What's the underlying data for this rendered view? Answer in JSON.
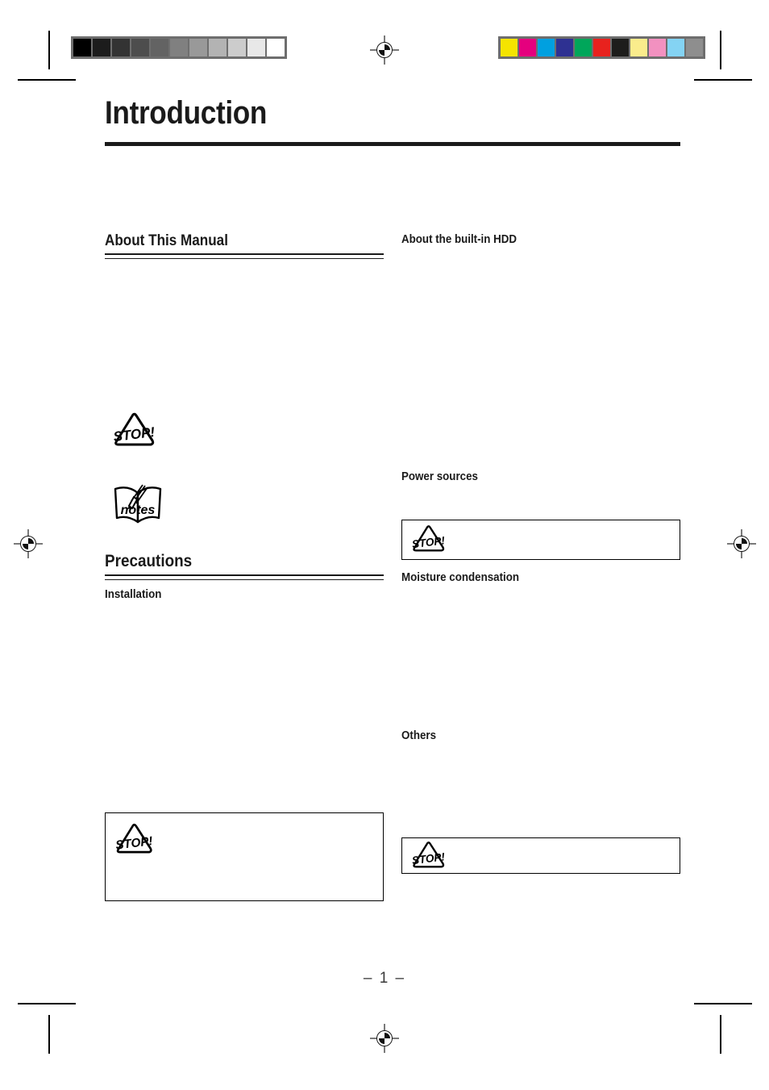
{
  "document": {
    "chapter_title": "Introduction",
    "page_number": "– 1 –"
  },
  "calibration": {
    "gray_bar": {
      "name": "grayscale-step-wedge",
      "swatches": [
        "#000000",
        "#1c1c1c",
        "#333333",
        "#4d4d4d",
        "#636363",
        "#808080",
        "#999999",
        "#b3b3b3",
        "#cccccc",
        "#e8e8e8",
        "#ffffff"
      ]
    },
    "color_bar": {
      "name": "process-color-bar",
      "swatches": [
        "#f5e400",
        "#e5007e",
        "#00a0e0",
        "#2e3192",
        "#00a65a",
        "#e8221e",
        "#1d1d1b",
        "#faec8c",
        "#f291c0",
        "#84d3f3",
        "#8e8e8e"
      ]
    }
  },
  "left_column": {
    "about_manual": {
      "heading": "About This Manual",
      "stop_icon_label": "STOP!",
      "notes_icon_label": "notes"
    },
    "precautions": {
      "heading": "Precautions",
      "installation_heading": "Installation",
      "caution_box_icon_label": "STOP!"
    }
  },
  "right_column": {
    "built_in_hdd_heading": "About the built-in HDD",
    "power_sources_heading": "Power sources",
    "power_sources_box_icon_label": "STOP!",
    "moisture_condensation_heading": "Moisture condensation",
    "others_heading": "Others",
    "others_box_icon_label": "STOP!"
  }
}
